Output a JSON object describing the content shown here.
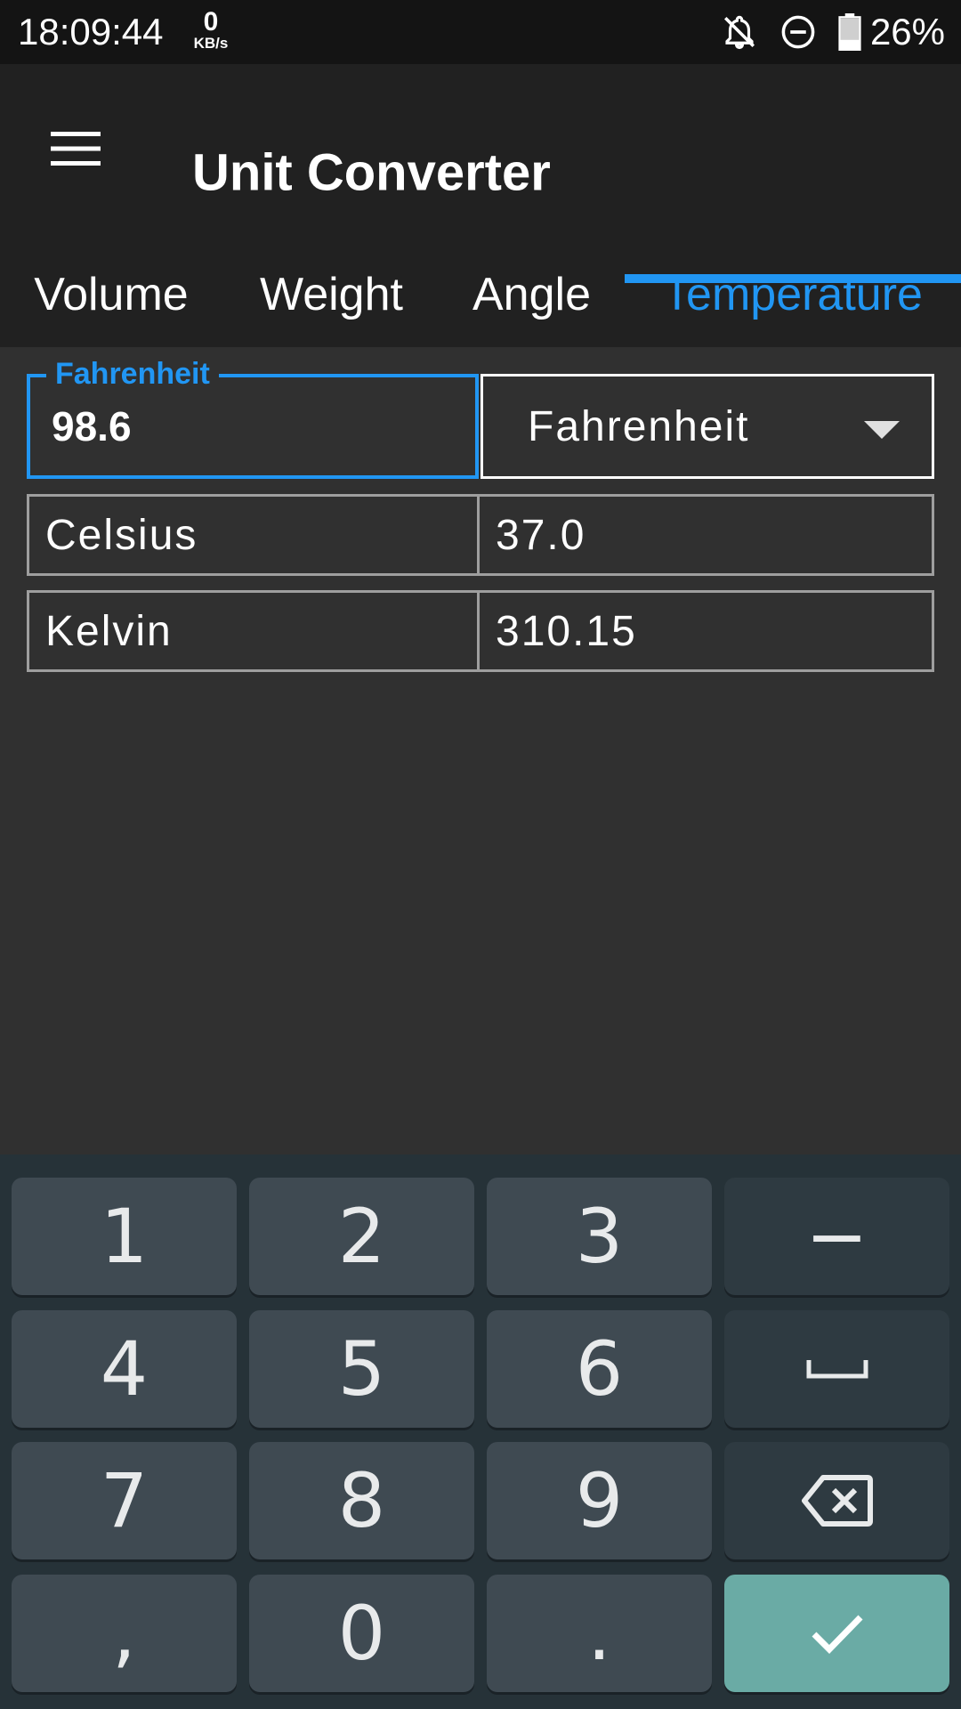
{
  "status_bar": {
    "time": "18:09:44",
    "net_speed_value": "0",
    "net_speed_unit": "KB/s",
    "icons": [
      "notifications-off-icon",
      "do-not-disturb-icon",
      "battery-icon"
    ],
    "battery_percent": "26%"
  },
  "app_bar": {
    "menu_icon": "hamburger-menu-icon",
    "title": "Unit Converter"
  },
  "tabs": [
    {
      "label": "Volume",
      "active": false
    },
    {
      "label": "Weight",
      "active": false
    },
    {
      "label": "Angle",
      "active": false
    },
    {
      "label": "Temperature",
      "active": true
    }
  ],
  "converter": {
    "input_label": "Fahrenheit",
    "input_value": "98.6",
    "selected_unit": "Fahrenheit",
    "results": [
      {
        "unit": "Celsius",
        "value": "37.0"
      },
      {
        "unit": "Kelvin",
        "value": "310.15"
      }
    ]
  },
  "keyboard": {
    "keys": [
      "1",
      "2",
      "3",
      "−",
      "4",
      "5",
      "6",
      "space",
      "7",
      "8",
      "9",
      "backspace",
      ",",
      "0",
      ".",
      "enter"
    ],
    "space_icon": "space-icon",
    "backspace_icon": "backspace-icon",
    "enter_icon": "checkmark-icon"
  },
  "colors": {
    "accent": "#2196f3",
    "background": "#303030",
    "app_bar": "#212121",
    "keyboard_bg": "#263238",
    "key": "#3f4a52",
    "enter_key": "#6aaba5"
  }
}
